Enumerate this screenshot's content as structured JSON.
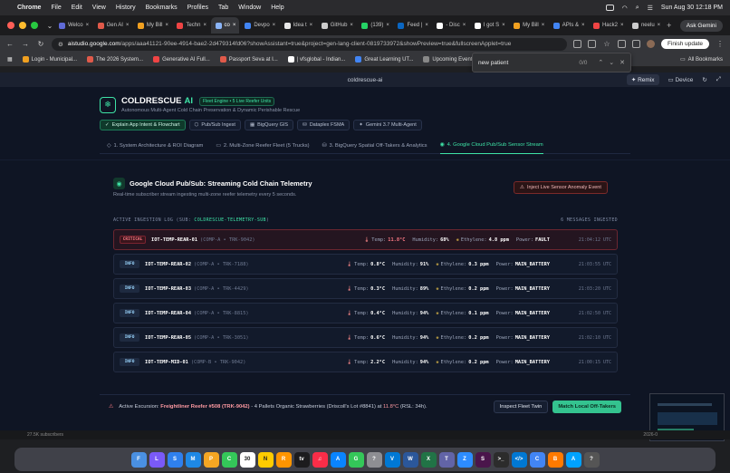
{
  "menubar": {
    "app": "Chrome",
    "items": [
      "File",
      "Edit",
      "View",
      "History",
      "Bookmarks",
      "Profiles",
      "Tab",
      "Window",
      "Help"
    ],
    "clock": "Sun Aug 30  12:18 PM"
  },
  "tabs": [
    {
      "label": "Welco",
      "color": "#5f6ad6"
    },
    {
      "label": "Gen AI",
      "color": "#e05a4a"
    },
    {
      "label": "My Bill",
      "color": "#f0a020"
    },
    {
      "label": "Techn",
      "color": "#ef4444"
    },
    {
      "label": "co",
      "color": "#8ab4f8",
      "active": true
    },
    {
      "label": "Devpo",
      "color": "#4285f4"
    },
    {
      "label": "Idea t",
      "color": "#e8e8e8"
    },
    {
      "label": "GitHub",
      "color": "#cccccc"
    },
    {
      "label": "(139)",
      "color": "#25d366"
    },
    {
      "label": "Feed |",
      "color": "#0a66c2"
    },
    {
      "label": "- Disc",
      "color": "#ffffff"
    },
    {
      "label": "I got S",
      "color": "#ffffff"
    },
    {
      "label": "My Bill",
      "color": "#f0a020"
    },
    {
      "label": "APIs &",
      "color": "#4285f4"
    },
    {
      "label": "Hack2",
      "color": "#ef4444"
    },
    {
      "label": "neelu",
      "color": "#cccccc"
    }
  ],
  "ask_gemini": "Ask Gemini",
  "url": {
    "host": "aistudio.google.com",
    "path": "/apps/aaa41121-90ee-4914-bae2-2d479314fd06?showAssistant=true&project=gen-lang-client-0819733972&showPreview=true&fullscreenApplet=true"
  },
  "finish_update": "Finish update",
  "bookmarks": [
    {
      "label": "Login - Municipal...",
      "color": "#f0a020"
    },
    {
      "label": "The 2026 System...",
      "color": "#e05a4a"
    },
    {
      "label": "Generative AI Full...",
      "color": "#ef4444"
    },
    {
      "label": "Passport Seva at I...",
      "color": "#e05a4a"
    },
    {
      "label": "| vfsglobal - Indian...",
      "color": "#ffffff"
    },
    {
      "label": "Great Learning UT...",
      "color": "#4285f4"
    },
    {
      "label": "Upcoming Events",
      "color": "#888888"
    },
    {
      "label": "Goog...",
      "color": "#4285f4"
    }
  ],
  "all_bookmarks": "All Bookmarks",
  "find": {
    "query": "new patient",
    "count": "0/0"
  },
  "applet": {
    "title": "coldrescue-ai",
    "remix": "Remix",
    "device": "Device"
  },
  "brand": {
    "name": "COLDRESCUE",
    "accent": "AI",
    "chip": "Fleet Engine • 5 Live Reefer Units",
    "subtitle": "Autonomous Multi-Agent Cold Chain Preservation & Dynamic Perishable Rescue"
  },
  "actions": [
    {
      "label": "Explain App Intent & Flowchart",
      "primary": true
    },
    {
      "label": "Pub/Sub Ingest"
    },
    {
      "label": "BigQuery GIS"
    },
    {
      "label": "Dataplex FSMA"
    },
    {
      "label": "Gemini 3.7 Multi-Agent"
    }
  ],
  "nav": [
    {
      "label": "1. System Architecture & ROI Diagram"
    },
    {
      "label": "2. Multi-Zone Reefer Fleet (5 Trucks)"
    },
    {
      "label": "3. BigQuery Spatial Off-Takers & Analytics"
    },
    {
      "label": "4. Google Cloud Pub/Sub Sensor Stream",
      "active": true
    }
  ],
  "section": {
    "title": "Google Cloud Pub/Sub: Streaming Cold Chain Telemetry",
    "subtitle": "Real-time subscriber stream ingesting multi-zone reefer telemetry every 5 seconds.",
    "inject_button": "Inject Live Sensor Anomaly Event"
  },
  "log": {
    "title": "ACTIVE INGESTION LOG (SUB:",
    "sub": "COLDRESCUE-TELEMETRY-SUB",
    "title_end": ")",
    "count": "6 MESSAGES INGESTED",
    "labels": {
      "temp": "Temp:",
      "humidity": "Humidity:",
      "ethylene": "Ethylene:",
      "power": "Power:"
    },
    "rows": [
      {
        "level": "CRITICAL",
        "device": "IOT-TEMP-REAR-01",
        "meta": "(COMP-A • TRK-9042)",
        "temp": "11.8°C",
        "humidity": "68%",
        "ethylene": "4.8 ppm",
        "power": "FAULT",
        "time": "21:04:12 UTC"
      },
      {
        "level": "INFO",
        "device": "IOT-TEMP-REAR-02",
        "meta": "(COMP-A • TRK-7188)",
        "temp": "0.8°C",
        "humidity": "91%",
        "ethylene": "0.3 ppm",
        "power": "MAIN_BATTERY",
        "time": "21:03:55 UTC"
      },
      {
        "level": "INFO",
        "device": "IOT-TEMP-REAR-03",
        "meta": "(COMP-A • TRK-4429)",
        "temp": "0.3°C",
        "humidity": "89%",
        "ethylene": "0.2 ppm",
        "power": "MAIN_BATTERY",
        "time": "21:03:20 UTC"
      },
      {
        "level": "INFO",
        "device": "IOT-TEMP-REAR-04",
        "meta": "(COMP-A • TRK-8815)",
        "temp": "0.4°C",
        "humidity": "94%",
        "ethylene": "0.1 ppm",
        "power": "MAIN_BATTERY",
        "time": "21:02:50 UTC"
      },
      {
        "level": "INFO",
        "device": "IOT-TEMP-REAR-05",
        "meta": "(COMP-A • TRK-3051)",
        "temp": "0.6°C",
        "humidity": "94%",
        "ethylene": "0.2 ppm",
        "power": "MAIN_BATTERY",
        "time": "21:02:10 UTC"
      },
      {
        "level": "INFO",
        "device": "IOT-TEMP-MID-01",
        "meta": "(COMP-B • TRK-9042)",
        "temp": "2.2°C",
        "humidity": "94%",
        "ethylene": "0.2 ppm",
        "power": "MAIN_BATTERY",
        "time": "21:00:15 UTC"
      }
    ]
  },
  "excursion": {
    "prefix": "Active Excursion:",
    "vehicle": "Freightliner Reefer #508 (TRK-9042)",
    "mid": "- 4 Pallets Organic Strawberries (Driscoll's Lot #8841) at",
    "temp": "11.8°C",
    "rsl": "(RSL: 34h).",
    "inspect": "Inspect Fleet Twin",
    "match": "Match Local Off-Takers"
  },
  "behind_text": {
    "left": "27.5K subscribers",
    "right": "2026-0"
  },
  "dock": [
    {
      "label": "F",
      "color": "#4a90e2"
    },
    {
      "label": "L",
      "color": "#7a5af8"
    },
    {
      "label": "S",
      "color": "#2f80ed"
    },
    {
      "label": "M",
      "color": "#1e88e5"
    },
    {
      "label": "P",
      "color": "#f5a623"
    },
    {
      "label": "C",
      "color": "#34c759"
    },
    {
      "label": "30",
      "color": "#ffffff"
    },
    {
      "label": "N",
      "color": "#ffcc00"
    },
    {
      "label": "R",
      "color": "#ff9500"
    },
    {
      "label": "tv",
      "color": "#1c1c1e"
    },
    {
      "label": "♫",
      "color": "#fa2d48"
    },
    {
      "label": "A",
      "color": "#0a84ff"
    },
    {
      "label": "G",
      "color": "#34c759"
    },
    {
      "label": "?",
      "color": "#8e8e93"
    },
    {
      "label": "V",
      "color": "#0078d4"
    },
    {
      "label": "W",
      "color": "#2b579a"
    },
    {
      "label": "X",
      "color": "#217346"
    },
    {
      "label": "T",
      "color": "#6264a7"
    },
    {
      "label": "Z",
      "color": "#2d8cff"
    },
    {
      "label": "S",
      "color": "#4a154b"
    },
    {
      "label": ">_",
      "color": "#2c2c2c"
    },
    {
      "label": "</>",
      "color": "#0078d4"
    },
    {
      "label": "C",
      "color": "#4285f4"
    },
    {
      "label": "B",
      "color": "#ff7a00"
    },
    {
      "label": "A",
      "color": "#00a2ff"
    },
    {
      "label": "?",
      "color": "#555555"
    }
  ]
}
